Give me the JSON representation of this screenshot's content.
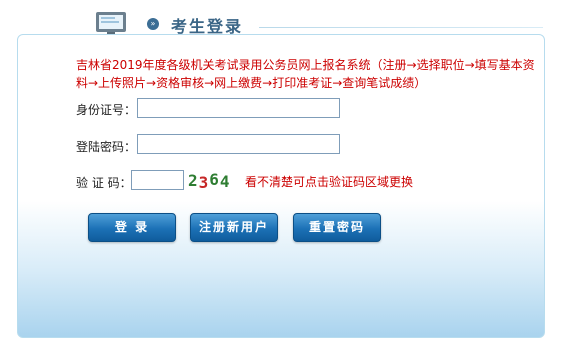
{
  "header": {
    "title": "考生登录",
    "arrow_glyph": "»"
  },
  "notice": "吉林省2019年度各级机关考试录用公务员网上报名系统（注册→选择职位→填写基本资料→上传照片→资格审核→网上缴费→打印准考证→查询笔试成绩）",
  "form": {
    "id_label": "身份证号：",
    "id_value": "",
    "password_label": "登陆密码：",
    "password_value": "",
    "captcha_label": "验 证 码：",
    "captcha_value": "",
    "captcha_chars": [
      "2",
      "3",
      "6",
      "4"
    ],
    "captcha_colors": [
      "#2e7d32",
      "#c62828",
      "#2e7d32",
      "#2e7d32"
    ],
    "captcha_hint": "看不清楚可点击验证码区域更换"
  },
  "buttons": {
    "login": "登 录",
    "register": "注册新用户",
    "reset_password": "重置密码"
  },
  "colors": {
    "title": "#3a6586",
    "notice": "#cc0000",
    "button": "#1c71b6"
  }
}
